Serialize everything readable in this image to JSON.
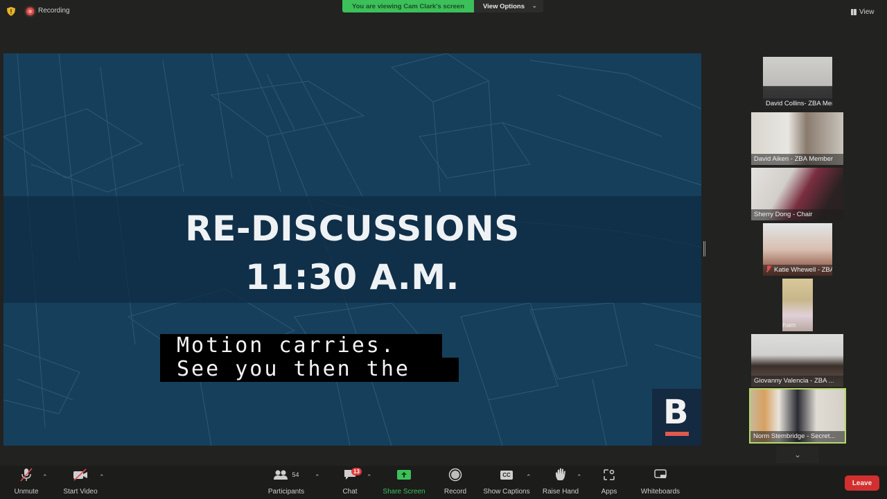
{
  "top_bar": {
    "recording_label": "Recording",
    "viewing_banner": "You are viewing Cam Clark's screen",
    "view_options_label": "View Options",
    "view_label": "View"
  },
  "slide": {
    "title_line1": "RE-DISCUSSIONS",
    "title_line2": "11:30 A.M.",
    "logo_letter": "B",
    "colors": {
      "background": "#163f5c",
      "band": "#0e2a42",
      "logo_bar": "#e05a4e"
    }
  },
  "captions": {
    "line1": "Motion carries.",
    "line2": "See you then the"
  },
  "participants_gallery": [
    {
      "name": "David Collins- ZBA Meme...",
      "muted": false,
      "active": false
    },
    {
      "name": "David Aiken - ZBA Member",
      "muted": false,
      "active": false
    },
    {
      "name": "Sherry Dong - Chair",
      "muted": false,
      "active": false
    },
    {
      "name": "Katie Whewell - ZBA M...",
      "muted": true,
      "active": false
    },
    {
      "name": "Alan Langham",
      "muted": false,
      "active": false
    },
    {
      "name": "Giovanny Valencia - ZBA ...",
      "muted": false,
      "active": false
    },
    {
      "name": "Norm Stembridge - Secret...",
      "muted": false,
      "active": true
    }
  ],
  "toolbar": {
    "unmute_label": "Unmute",
    "start_video_label": "Start Video",
    "participants_label": "Participants",
    "participants_count": "54",
    "chat_label": "Chat",
    "chat_badge": "13",
    "share_screen_label": "Share Screen",
    "record_label": "Record",
    "show_captions_label": "Show Captions",
    "captions_icon_text": "CC",
    "raise_hand_label": "Raise Hand",
    "apps_label": "Apps",
    "whiteboards_label": "Whiteboards",
    "leave_label": "Leave"
  },
  "colors": {
    "accent_green": "#3cc05a",
    "leave_red": "#d0302f",
    "active_speaker_border": "#b5d96a",
    "badge_red": "#e03a3a"
  }
}
